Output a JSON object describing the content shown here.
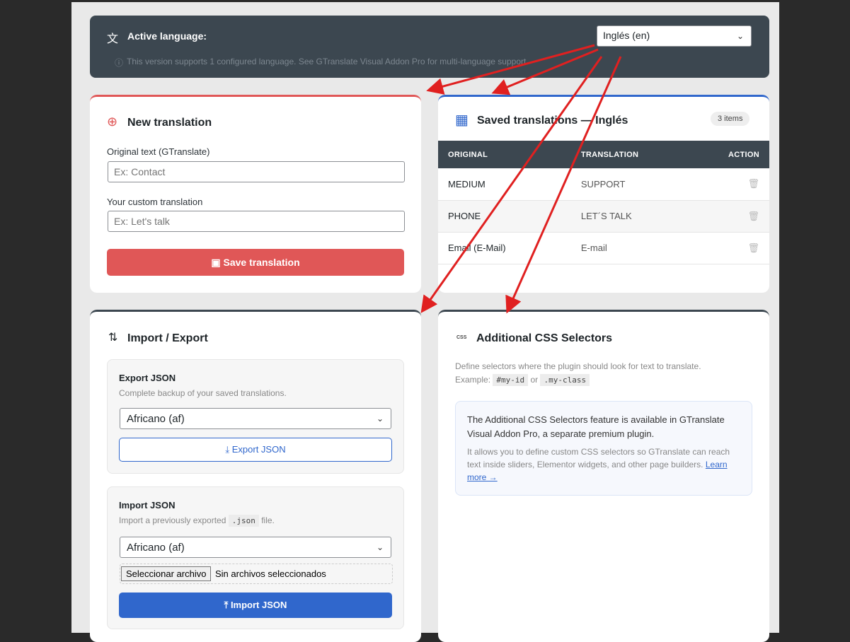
{
  "banner": {
    "title": "Active language:",
    "selected_language": "Inglés (en)",
    "notice": "This version supports 1 configured language. See GTranslate Visual Addon Pro for multi-language support."
  },
  "new_translation": {
    "title": "New translation",
    "original_label": "Original text (GTranslate)",
    "original_placeholder": "Ex: Contact",
    "custom_label": "Your custom translation",
    "custom_placeholder": "Ex: Let's talk",
    "save_label": "Save translation"
  },
  "saved": {
    "title": "Saved translations — Inglés",
    "count": "3 items",
    "headers": [
      "ORIGINAL",
      "TRANSLATION",
      "ACTION"
    ],
    "rows": [
      {
        "original": "MEDIUM",
        "translation": "SUPPORT"
      },
      {
        "original": "PHONE",
        "translation": "LET´S TALK"
      },
      {
        "original": "Email (E-Mail)",
        "translation": "E-mail"
      }
    ]
  },
  "import_export": {
    "title": "Import / Export",
    "export": {
      "title": "Export JSON",
      "desc": "Complete backup of your saved translations.",
      "language": "Africano (af)",
      "button": "Export JSON"
    },
    "import": {
      "title": "Import JSON",
      "desc_before": "Import a previously exported",
      "desc_code": ".json",
      "desc_after": "file.",
      "language": "Africano (af)",
      "file_button": "Seleccionar archivo",
      "file_status": "Sin archivos seleccionados",
      "button": "Import JSON"
    }
  },
  "css_selectors": {
    "icon_text": "CSS",
    "title": "Additional CSS Selectors",
    "desc": "Define selectors where the plugin should look for text to translate.",
    "example_label": "Example:",
    "example_id": "#my-id",
    "example_or": "or",
    "example_class": ".my-class",
    "notice_main": "The Additional CSS Selectors feature is available in GTranslate Visual Addon Pro, a separate premium plugin.",
    "notice_sub": "It allows you to define custom CSS selectors so GTranslate can reach text inside sliders, Elementor widgets, and other page builders.",
    "learn_more": "Learn more →"
  },
  "colors": {
    "red": "#e05757",
    "blue": "#3067cc",
    "dark": "#3c4750"
  }
}
